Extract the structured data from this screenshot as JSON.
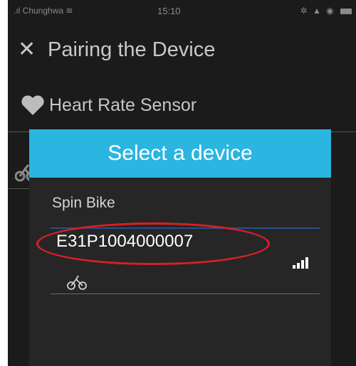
{
  "status_bar": {
    "carrier": ".ıl Chunghwa",
    "wifi_icon": "wifi-icon",
    "time": "15:10",
    "indicators": "✲ ▲ ◉"
  },
  "header": {
    "close_icon": "close-icon",
    "title": "Pairing the Device"
  },
  "sensor_row": {
    "icon": "heart-icon",
    "label": "Heart Rate Sensor"
  },
  "dialog": {
    "title": "Select a device",
    "device_type": "Spin Bike",
    "devices": [
      {
        "id": "E31P1004000007",
        "signal_icon": "signal-strength-icon",
        "type_icon": "bike-icon",
        "highlighted": true
      }
    ]
  },
  "colors": {
    "background": "#1b1b1b",
    "dialog_bg": "#262626",
    "header_accent": "#2bb5e1",
    "highlight_ring": "#d81f27",
    "selection_underline": "#2a4e8f"
  }
}
